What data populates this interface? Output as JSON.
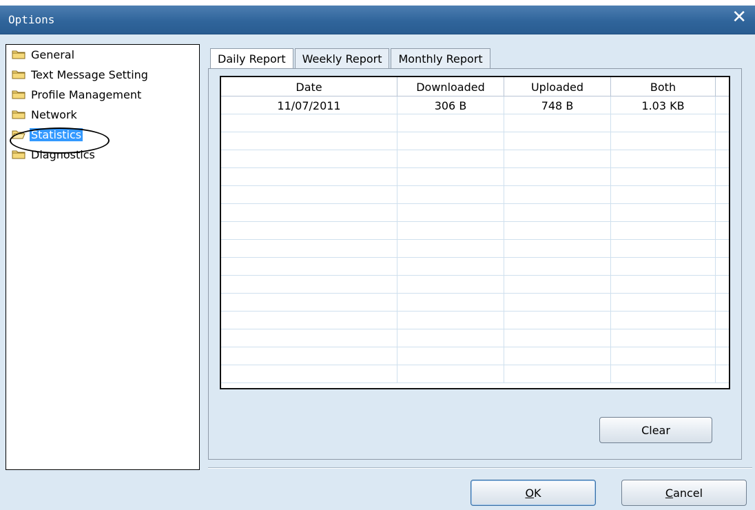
{
  "window": {
    "title": "Options",
    "close_glyph": "✕"
  },
  "tree": {
    "items": [
      {
        "label": "General",
        "icon": "folder-icon"
      },
      {
        "label": "Text Message Setting",
        "icon": "folder-icon"
      },
      {
        "label": "Profile Management",
        "icon": "folder-icon"
      },
      {
        "label": "Network",
        "icon": "folder-icon"
      },
      {
        "label": "Statistics",
        "icon": "folder-open-icon",
        "selected": true
      },
      {
        "label": "Diagnostics",
        "icon": "folder-icon"
      }
    ]
  },
  "tabs": [
    {
      "label": "Daily Report",
      "active": true
    },
    {
      "label": "Weekly Report",
      "active": false
    },
    {
      "label": "Monthly Report",
      "active": false
    }
  ],
  "table": {
    "columns": [
      "Date",
      "Downloaded",
      "Uploaded",
      "Both"
    ],
    "rows": [
      [
        "11/07/2011",
        "306 B",
        "748 B",
        "1.03 KB"
      ]
    ]
  },
  "buttons": {
    "clear": "Clear",
    "ok_mnemonic": "O",
    "ok_rest": "K",
    "cancel_mnemonic": "C",
    "cancel_rest": "ancel"
  },
  "colors": {
    "titlebar": "#30659b",
    "background": "#dbe8f3",
    "selection": "#3399ff"
  }
}
